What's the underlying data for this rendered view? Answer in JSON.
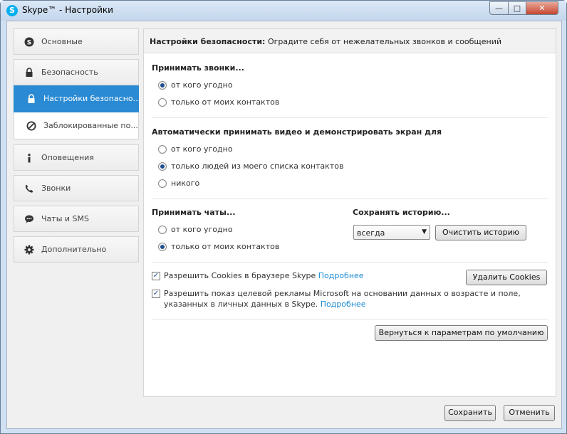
{
  "window": {
    "logo_letter": "S",
    "title": "Skype™ - Настройки",
    "min_glyph": "—",
    "max_glyph": "□",
    "close_glyph": "✕"
  },
  "sidebar": {
    "items": [
      {
        "label": "Основные",
        "icon": "skype-icon"
      },
      {
        "label": "Безопасность",
        "icon": "lock-icon"
      },
      {
        "label": "Оповещения",
        "icon": "info-icon"
      },
      {
        "label": "Звонки",
        "icon": "phone-icon"
      },
      {
        "label": "Чаты и SMS",
        "icon": "chat-icon"
      },
      {
        "label": "Дополнительно",
        "icon": "gear-icon"
      }
    ],
    "subitems": [
      {
        "label": "Настройки безопасно...",
        "icon": "lock-icon",
        "active": true
      },
      {
        "label": "Заблокированные по...",
        "icon": "block-icon",
        "active": false
      }
    ]
  },
  "header": {
    "bold": "Настройки безопасности:",
    "text": " Оградите себя от нежелательных звонков и сообщений"
  },
  "calls": {
    "title": "Принимать звонки...",
    "options": [
      "от кого угодно",
      "только от моих контактов"
    ],
    "selected": 0
  },
  "video": {
    "title": "Автоматически принимать видео и демонстрировать экран для",
    "options": [
      "от кого угодно",
      "только людей из моего списка контактов",
      "никого"
    ],
    "selected": 1
  },
  "chats": {
    "title": "Принимать чаты...",
    "options": [
      "от кого угодно",
      "только от моих контактов"
    ],
    "selected": 1
  },
  "history": {
    "title": "Сохранять историю...",
    "value": "всегда",
    "clear_label": "Очистить историю"
  },
  "cookies": {
    "checked": true,
    "text": "Разрешить Cookies в браузере Skype",
    "link": "Подробнее",
    "delete_label": "Удалить Cookies"
  },
  "ads": {
    "checked": true,
    "text": "Разрешить показ целевой рекламы Microsoft на основании данных о возрасте и поле, указанных в личных данных в Skype.",
    "link": "Подробнее"
  },
  "defaults_label": "Вернуться к параметрам по умолчанию",
  "footer": {
    "save_label": "Сохранить",
    "cancel_label": "Отменить"
  },
  "colors": {
    "accent": "#2a8ad3",
    "link": "#1a8ad1",
    "skype": "#00aff0"
  }
}
